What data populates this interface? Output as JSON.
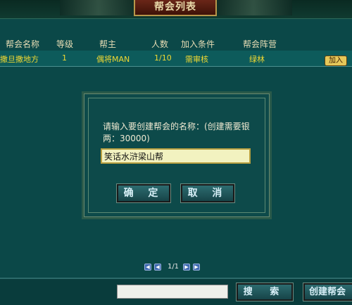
{
  "window": {
    "title": "帮会列表"
  },
  "table": {
    "headers": [
      "帮会名称",
      "等级",
      "帮主",
      "人数",
      "加入条件",
      "帮会阵营"
    ],
    "rows": [
      {
        "name": "撒旦撒地方",
        "level": "1",
        "leader": "偶将MAN",
        "members": "1/10",
        "condition": "需审核",
        "camp": "绿林",
        "action": "加入"
      }
    ]
  },
  "dialog": {
    "prompt": "请输入要创建帮会的名称：(创建需要银两：30000)",
    "input_value": "笑话水浒梁山帮",
    "ok_label": "确 定",
    "cancel_label": "取 消"
  },
  "pagination": {
    "text": "1/1"
  },
  "bottom": {
    "search_value": "",
    "search_label": "搜 索",
    "create_label": "创建帮会"
  }
}
